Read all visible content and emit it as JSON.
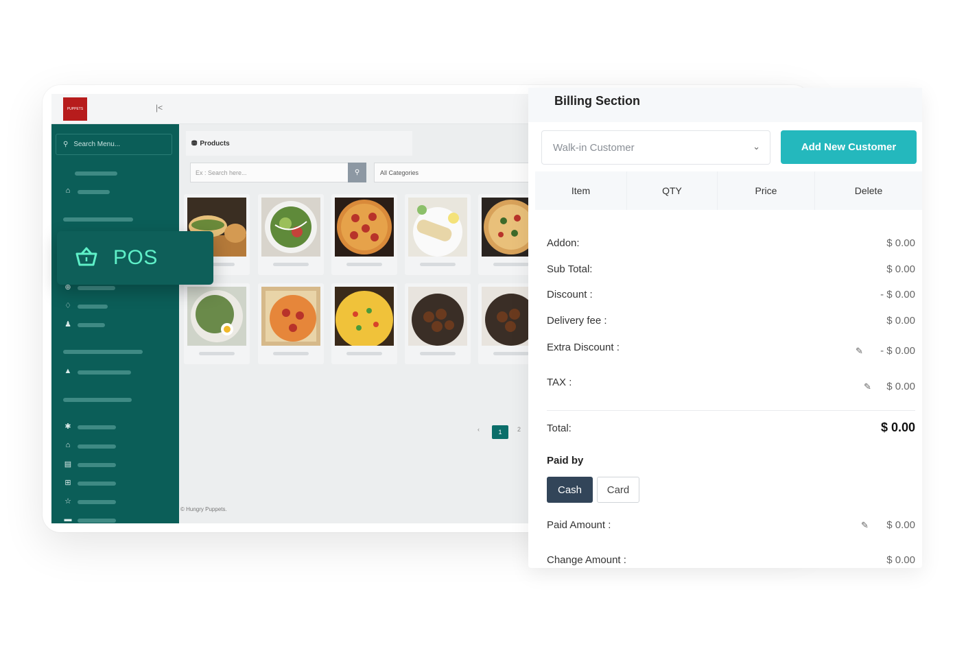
{
  "sidebar": {
    "logo_text": "PUPPETS",
    "search_placeholder": "Search Menu...",
    "collapse_icon": "collapse-left-icon",
    "popup_label": "POS",
    "popup_icon": "basket-icon"
  },
  "products": {
    "heading": "Products",
    "search_placeholder": "Ex : Search here...",
    "category_selected": "All Categories",
    "pagination": {
      "prev": "‹",
      "pages": [
        "1",
        "2"
      ],
      "active": "1"
    },
    "footer": "© Hungry Puppets."
  },
  "billing": {
    "title": "Billing Section",
    "customer_selected": "Walk-in Customer",
    "add_customer_label": "Add New Customer",
    "columns": [
      "Item",
      "QTY",
      "Price",
      "Delete"
    ],
    "rows": {
      "addon": {
        "label": "Addon:",
        "value": "$ 0.00"
      },
      "subtotal": {
        "label": "Sub Total:",
        "value": "$ 0.00"
      },
      "discount": {
        "label": "Discount :",
        "value": "- $ 0.00"
      },
      "delivery": {
        "label": "Delivery fee :",
        "value": "$ 0.00"
      },
      "extra_discount": {
        "label": "Extra Discount :",
        "value": "- $ 0.00"
      },
      "tax": {
        "label": "TAX :",
        "value": "$ 0.00"
      },
      "total": {
        "label": "Total:",
        "value": "$ 0.00"
      },
      "paid_amount": {
        "label": "Paid Amount :",
        "value": "$ 0.00"
      },
      "change_amount": {
        "label": "Change Amount :",
        "value": "$ 0.00"
      }
    },
    "paid_by_label": "Paid by",
    "payment_methods": [
      "Cash",
      "Card"
    ],
    "payment_selected": "Cash"
  },
  "colors": {
    "sidebar": "#0b5e58",
    "accent": "#24b8bd",
    "pos_text": "#5ff0c8",
    "cash_button": "#324559"
  }
}
